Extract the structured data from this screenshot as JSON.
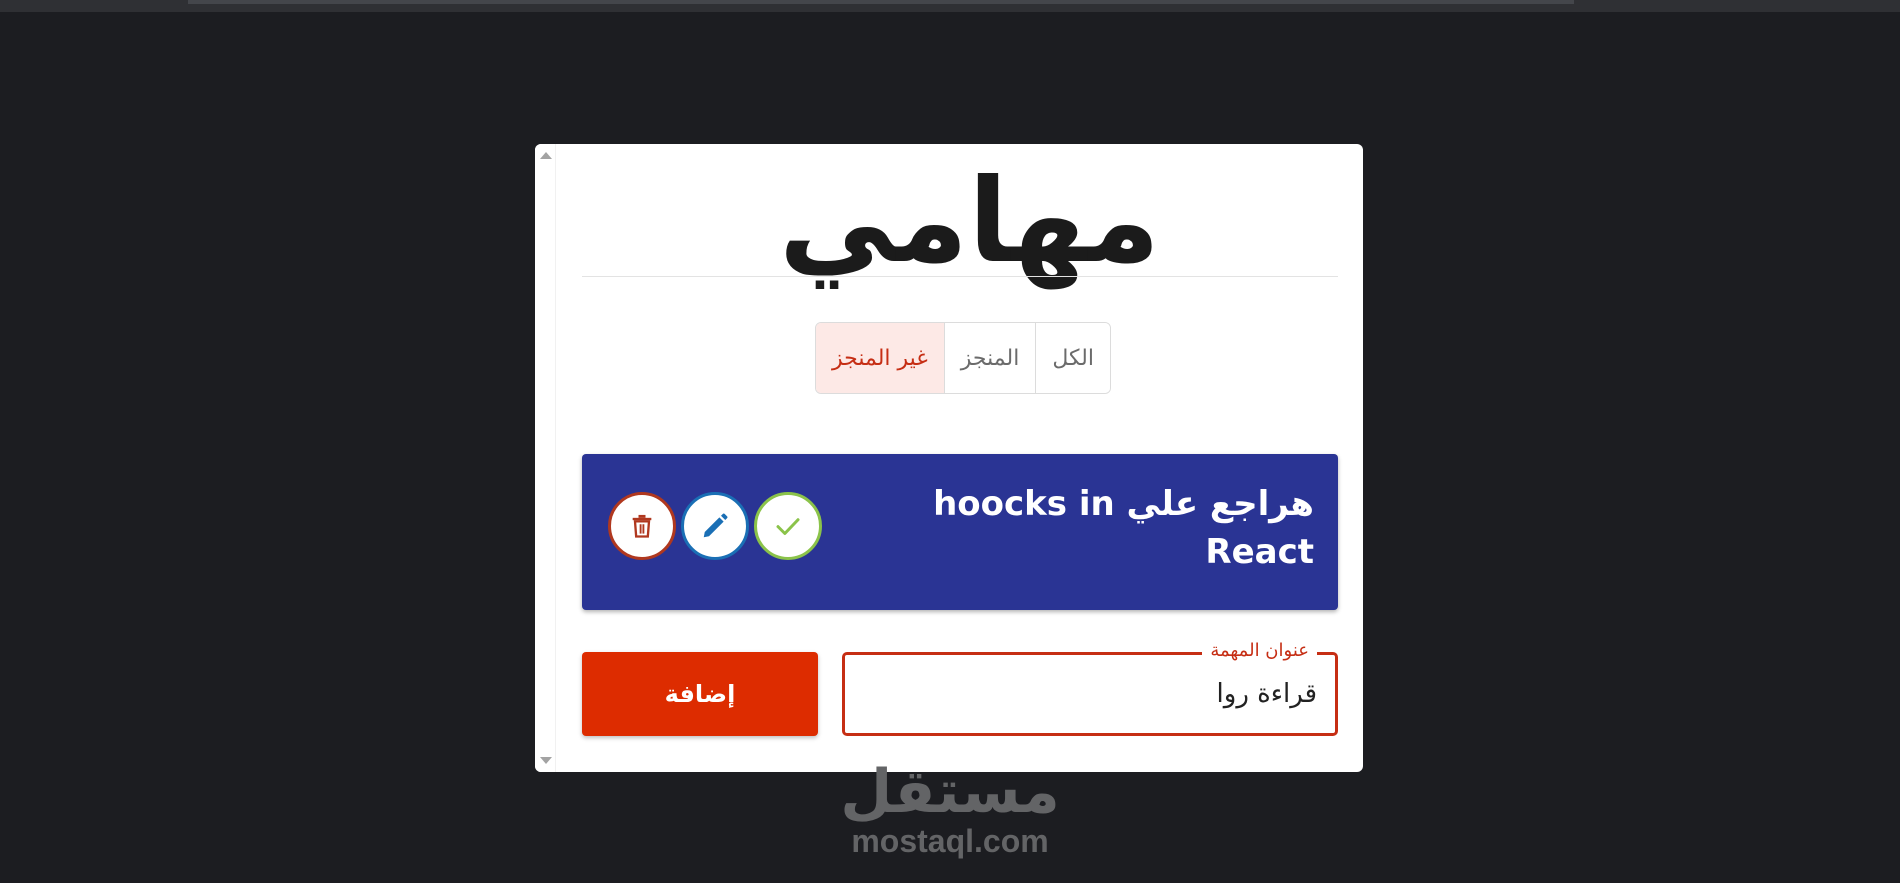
{
  "app": {
    "title": "مهامي"
  },
  "filters": {
    "items": [
      {
        "label": "الكل",
        "active": false
      },
      {
        "label": "المنجز",
        "active": false
      },
      {
        "label": "غير المنجز",
        "active": true
      }
    ]
  },
  "tasks": [
    {
      "title": "هراجع علي hoocks in React",
      "actions": {
        "done_icon": "check-icon",
        "edit_icon": "pencil-icon",
        "delete_icon": "trash-icon"
      }
    }
  ],
  "form": {
    "input_label": "عنوان المهمة",
    "input_value": "قراءة روا",
    "add_button_label": "إضافة"
  },
  "watermark": {
    "arabic": "مستقل",
    "domain": "mostaql.com"
  },
  "colors": {
    "background": "#1c1d21",
    "task_card": "#2a3494",
    "accent": "#dd2c00",
    "active_filter_text": "#c62e14",
    "done": "#8bc34a",
    "edit": "#1a6fb5",
    "delete": "#b0381f"
  }
}
